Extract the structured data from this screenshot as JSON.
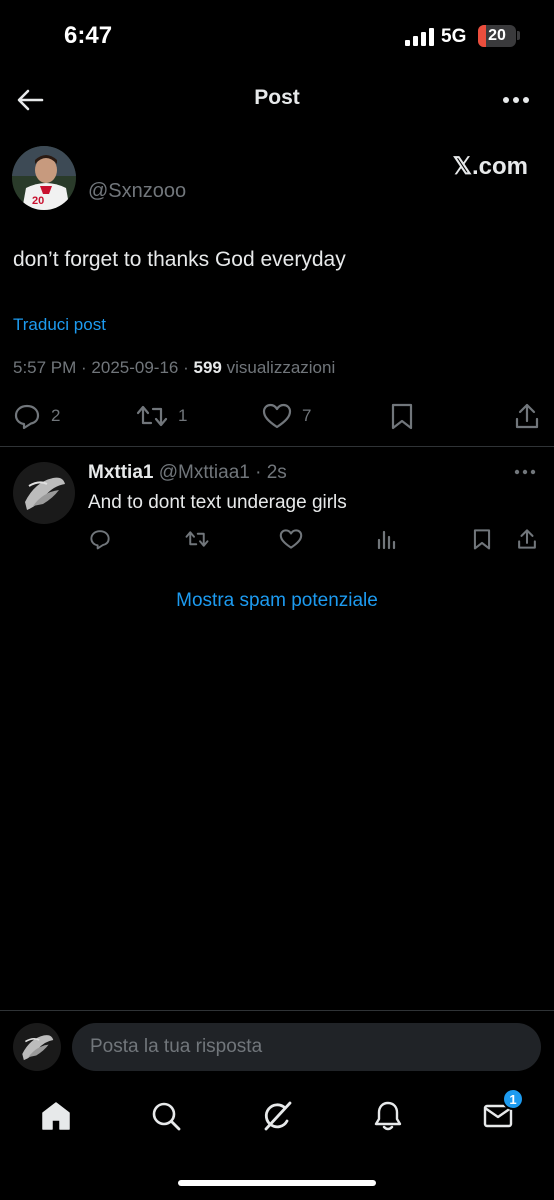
{
  "status_bar": {
    "time": "6:47",
    "network": "5G",
    "battery": "20",
    "battery_level": 0.2
  },
  "header": {
    "title": "Post",
    "back_icon": "arrow-left-icon",
    "more_icon": "more-horizontal-icon"
  },
  "post": {
    "handle": "@Sxnzooo",
    "source": "𝕏.com",
    "text": "don’t forget to thanks God everyday",
    "translate_label": "Traduci post",
    "meta_prefix": "5:57 PM · 2025-09-16 · ",
    "views_count": "599",
    "views_label": " visualizzazioni",
    "stats": {
      "replies": "2",
      "reposts": "1",
      "likes": "7"
    }
  },
  "reply": {
    "name": "Mxttia1",
    "handle_time": " @Mxttiaa1 · 2s",
    "text": "And to dont text underage girls"
  },
  "spam_link": "Mostra spam potenziale",
  "composer": {
    "placeholder": "Posta la tua risposta"
  },
  "tabbar": {
    "messages_badge": "1"
  },
  "colors": {
    "accent": "#1d9bf0",
    "background": "#000000",
    "muted": "#71767b",
    "text": "#e7e9ea"
  }
}
